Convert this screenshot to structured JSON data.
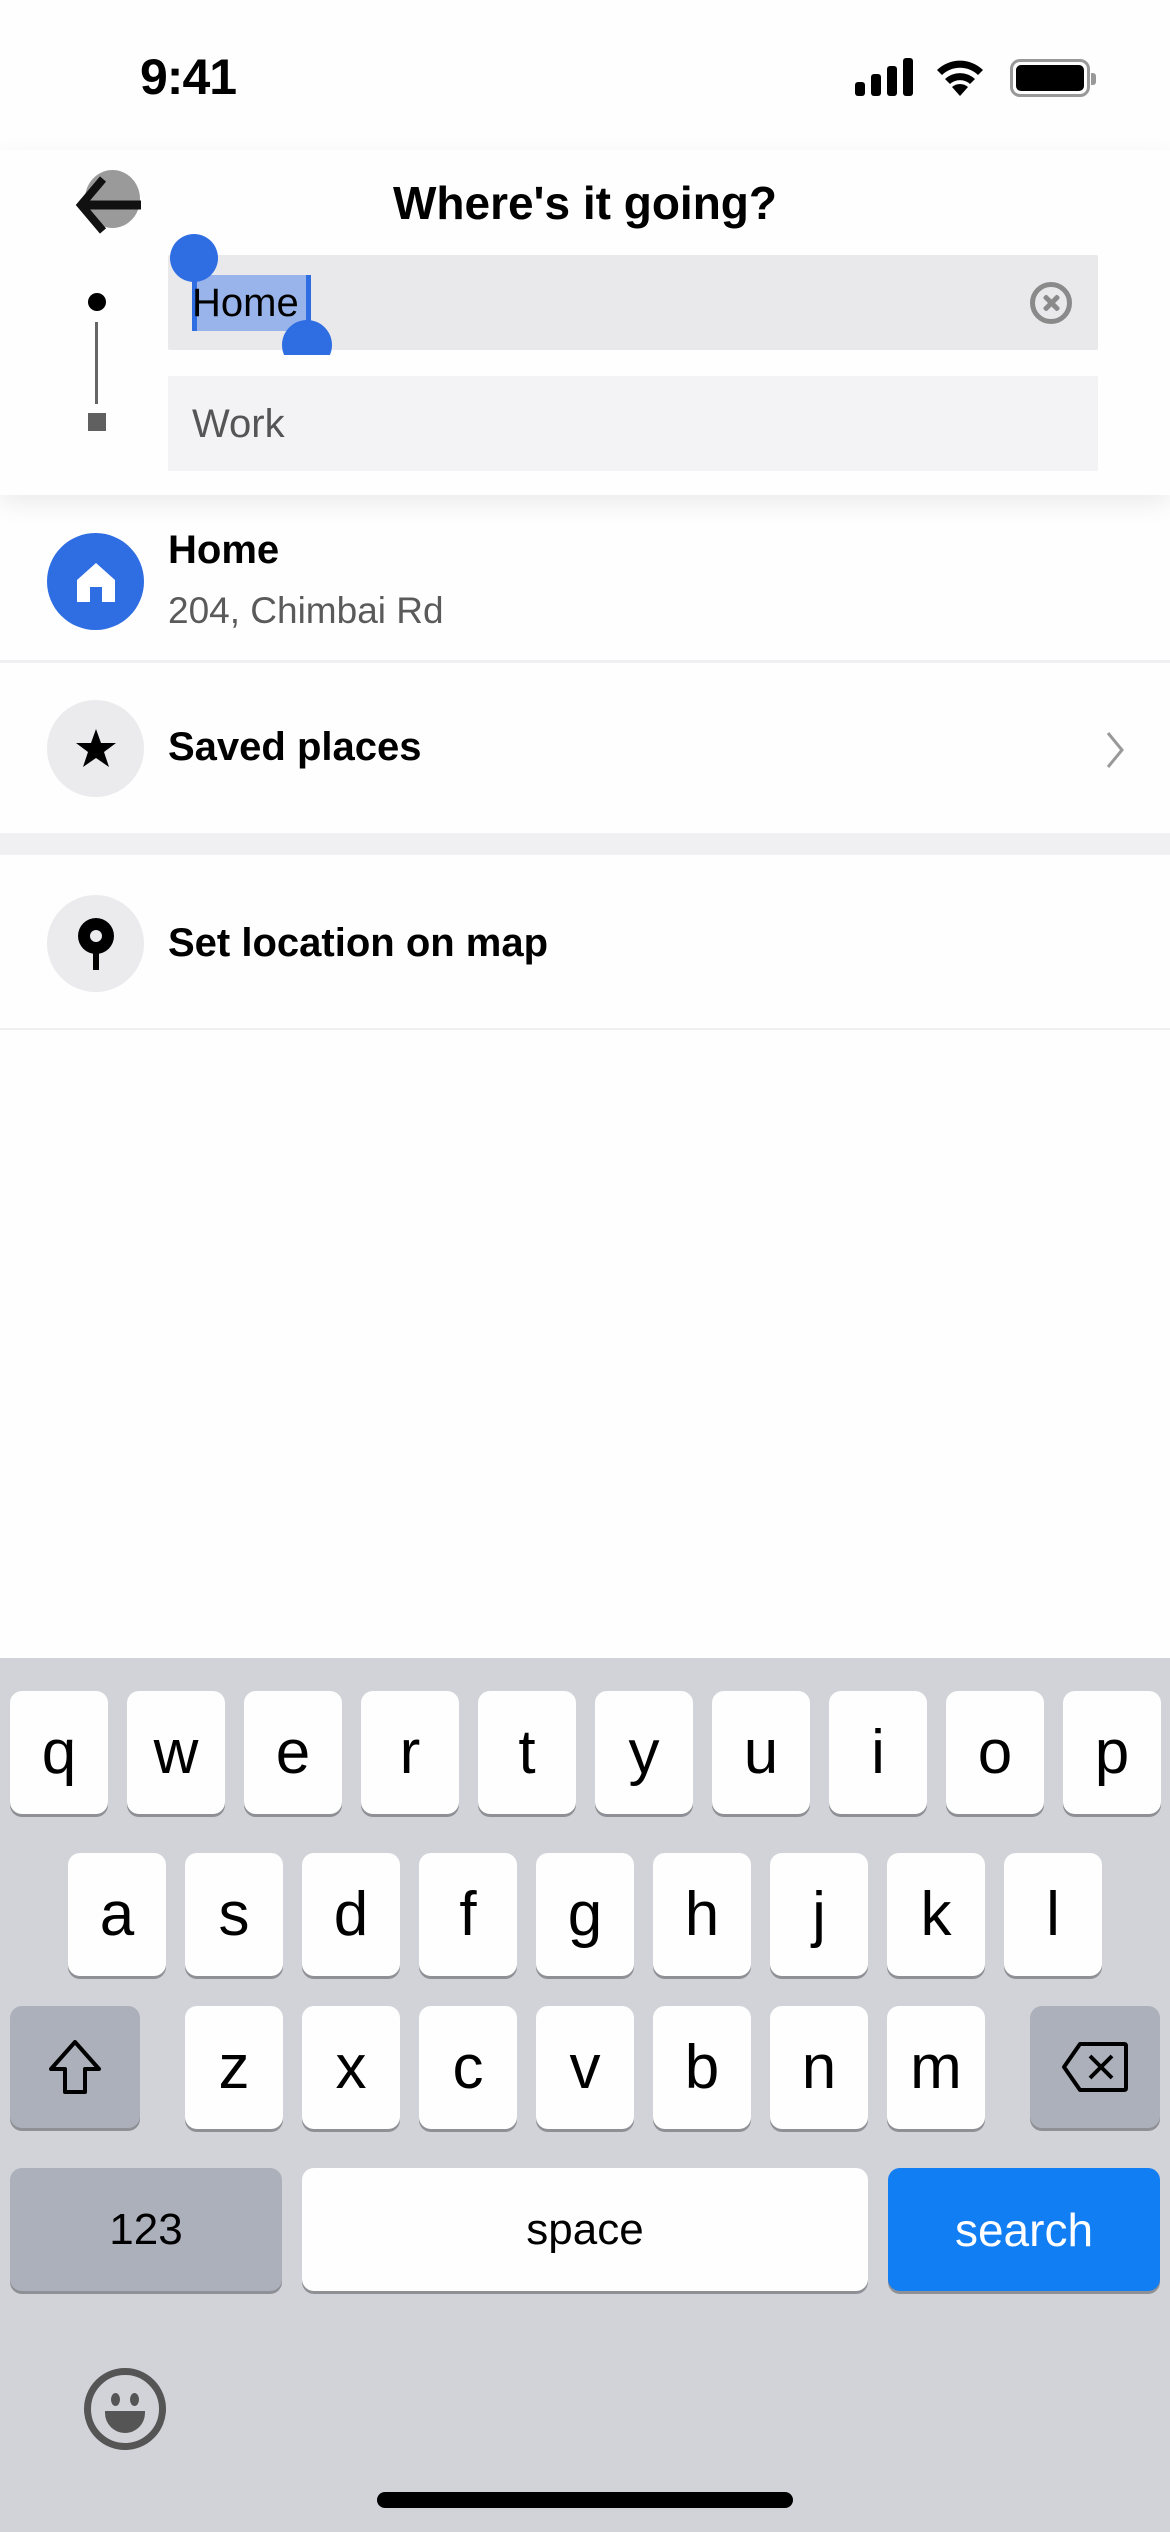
{
  "status_bar": {
    "time": "9:41",
    "icons": [
      "cellular-signal-icon",
      "wifi-icon",
      "battery-icon"
    ]
  },
  "header": {
    "title": "Where's it going?",
    "back_icon": "arrow-left-icon"
  },
  "route": {
    "pickup": {
      "value": "Home",
      "selected_text": "Home",
      "clear_icon": "clear-circle-x-icon"
    },
    "destination": {
      "placeholder": "Work"
    }
  },
  "list": {
    "items": [
      {
        "icon": "house-icon",
        "title": "Home",
        "subtitle": "204, Chimbai Rd"
      },
      {
        "icon": "star-icon",
        "title": "Saved places",
        "trailing_icon": "chevron-right-icon"
      },
      {
        "icon": "map-pin-icon",
        "title": "Set location on map"
      }
    ]
  },
  "keyboard": {
    "row1": [
      "q",
      "w",
      "e",
      "r",
      "t",
      "y",
      "u",
      "i",
      "o",
      "p"
    ],
    "row2": [
      "a",
      "s",
      "d",
      "f",
      "g",
      "h",
      "j",
      "k",
      "l"
    ],
    "row3": [
      "z",
      "x",
      "c",
      "v",
      "b",
      "n",
      "m"
    ],
    "shift_icon": "shift-arrow-icon",
    "delete_icon": "backspace-icon",
    "numbers_label": "123",
    "space_label": "space",
    "action_label": "search",
    "emoji_icon": "emoji-smile-icon"
  },
  "colors": {
    "accent_blue": "#2f6de3",
    "keyboard_action_blue": "#127ef3",
    "field_bg": "#e9e8ea",
    "keyboard_bg": "#d2d3d8"
  }
}
